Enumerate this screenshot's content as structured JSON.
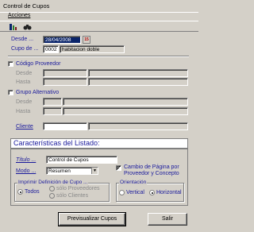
{
  "window": {
    "title": "Control de Cupos"
  },
  "menu": {
    "acciones": "Acciones"
  },
  "toolbar": {
    "icons": [
      "filter-icon",
      "binoculars-icon"
    ]
  },
  "filters": {
    "desde_label": "Desde ...",
    "desde_value": "28/04/2008",
    "cupo_label": "Cupo de ...",
    "cupo_code": "0002",
    "cupo_desc": "habitacion doble",
    "codigo_proveedor_label": "Código Proveedor",
    "codigo_proveedor_checked": false,
    "cp_desde_label": "Desde",
    "cp_hasta_label": "Hasta",
    "grupo_alternativo_label": "Grupo Alternativo",
    "grupo_alternativo_checked": false,
    "ga_desde_label": "Desde",
    "ga_hasta_label": "Hasta",
    "cliente_label": "Cliente"
  },
  "listado": {
    "section_title": "Características del Listado:",
    "titulo_label": "Título ...",
    "titulo_value": "Control de Cupos",
    "modo_label": "Modo ...",
    "modo_value": "Resumen",
    "cambio_pagina_label": "Cambio de Página por Proveedor y Concepto",
    "cambio_pagina_checked": true,
    "imprimir_group_title": "Imprimir Definición de Cupo ...",
    "imprimir_options": [
      "Todos",
      "sólo Proveedores",
      "sólo Clientes"
    ],
    "imprimir_selected": "Todos",
    "orientacion_group_title": "Orientación",
    "orientacion_options": [
      "Vertical",
      "Horizontal"
    ],
    "orientacion_selected": "Horizontal"
  },
  "buttons": {
    "previsualizar": "Previsualizar Cupos",
    "salir": "Salir"
  }
}
